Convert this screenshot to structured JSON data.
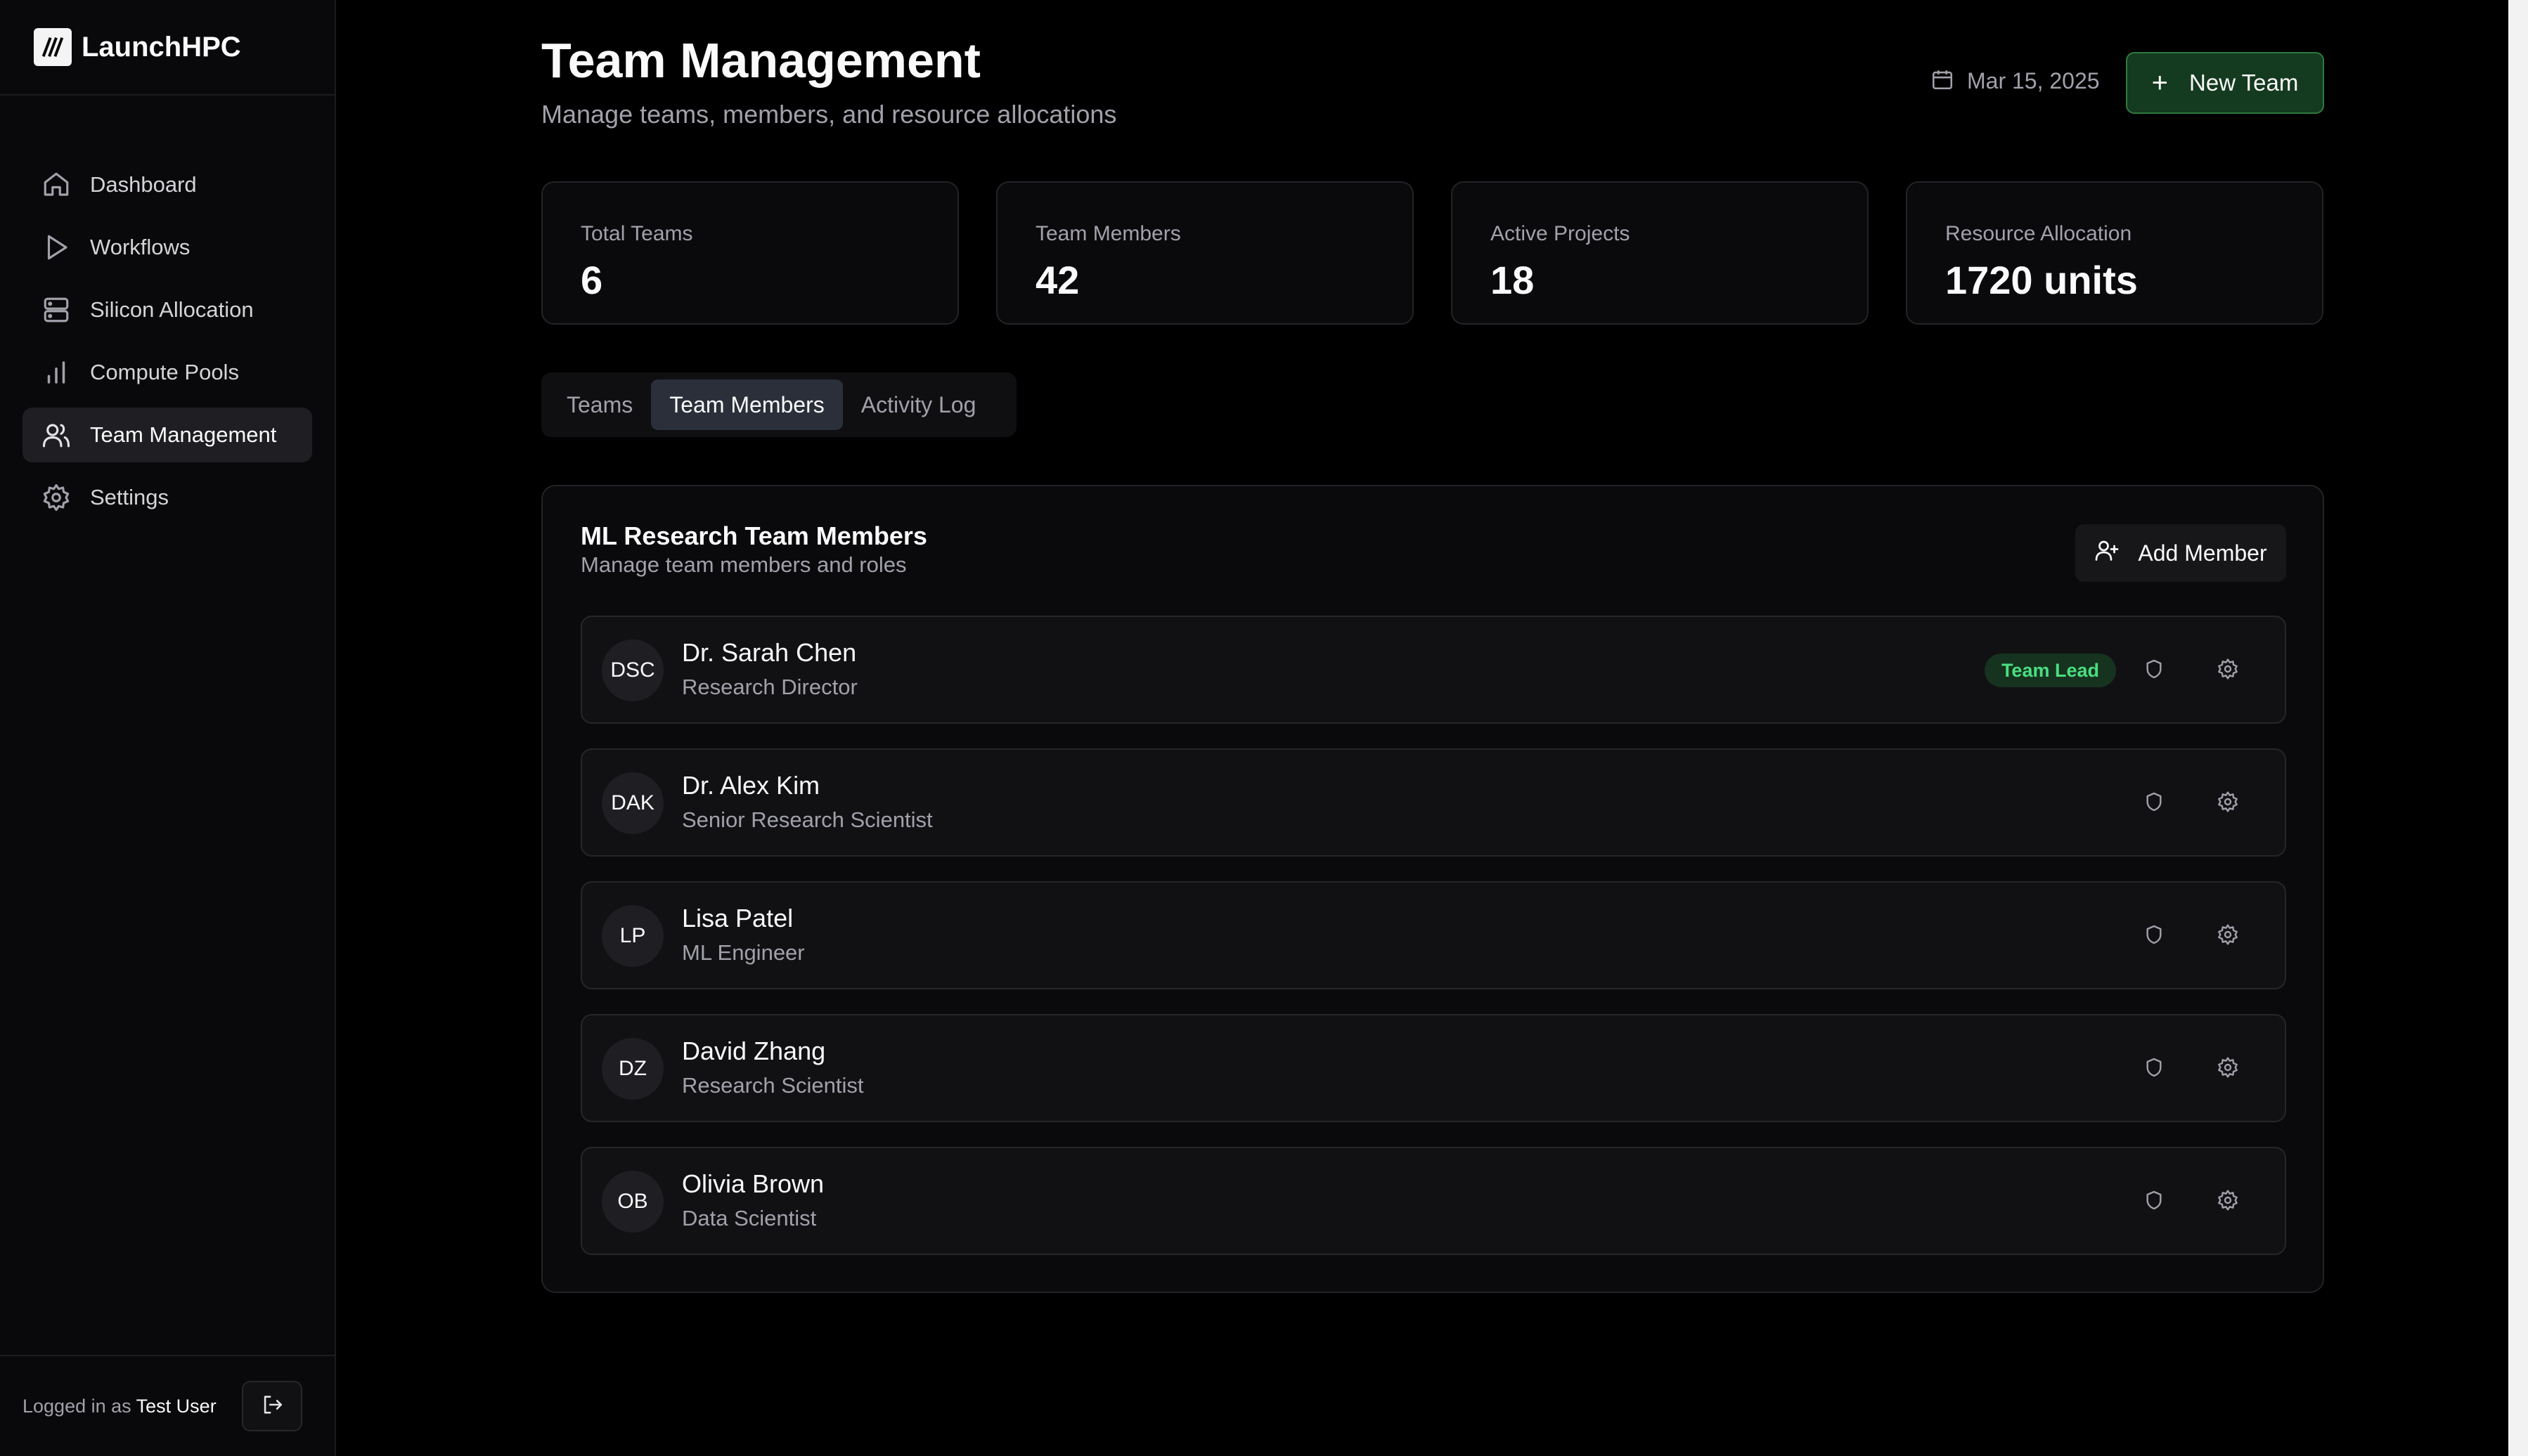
{
  "brand": {
    "name": "LaunchHPC"
  },
  "sidebar": {
    "items": [
      {
        "label": "Dashboard",
        "icon": "home-icon"
      },
      {
        "label": "Workflows",
        "icon": "play-icon"
      },
      {
        "label": "Silicon Allocation",
        "icon": "server-icon"
      },
      {
        "label": "Compute Pools",
        "icon": "bar-chart-icon"
      },
      {
        "label": "Team Management",
        "icon": "users-icon",
        "active": true
      },
      {
        "label": "Settings",
        "icon": "gear-icon"
      }
    ],
    "footer": {
      "logged_prefix": "Logged in as",
      "user": "Test User"
    }
  },
  "header": {
    "title": "Team Management",
    "subtitle": "Manage teams, members, and resource allocations",
    "date": "Mar 15, 2025",
    "new_team_label": "New Team"
  },
  "stats": [
    {
      "label": "Total Teams",
      "value": "6"
    },
    {
      "label": "Team Members",
      "value": "42"
    },
    {
      "label": "Active Projects",
      "value": "18"
    },
    {
      "label": "Resource Allocation",
      "value": "1720 units"
    }
  ],
  "tabs": [
    {
      "label": "Teams"
    },
    {
      "label": "Team Members",
      "active": true
    },
    {
      "label": "Activity Log"
    }
  ],
  "members_card": {
    "title": "ML Research Team Members",
    "subtitle": "Manage team members and roles",
    "add_label": "Add Member",
    "members": [
      {
        "initials": "DSC",
        "name": "Dr. Sarah Chen",
        "role": "Research Director",
        "badge": "Team Lead"
      },
      {
        "initials": "DAK",
        "name": "Dr. Alex Kim",
        "role": "Senior Research Scientist"
      },
      {
        "initials": "LP",
        "name": "Lisa Patel",
        "role": "ML Engineer"
      },
      {
        "initials": "DZ",
        "name": "David Zhang",
        "role": "Research Scientist"
      },
      {
        "initials": "OB",
        "name": "Olivia Brown",
        "role": "Data Scientist"
      }
    ]
  },
  "colors": {
    "accent_green": "#4ade80",
    "new_team_bg": "#143a1f",
    "background": "#000000"
  }
}
